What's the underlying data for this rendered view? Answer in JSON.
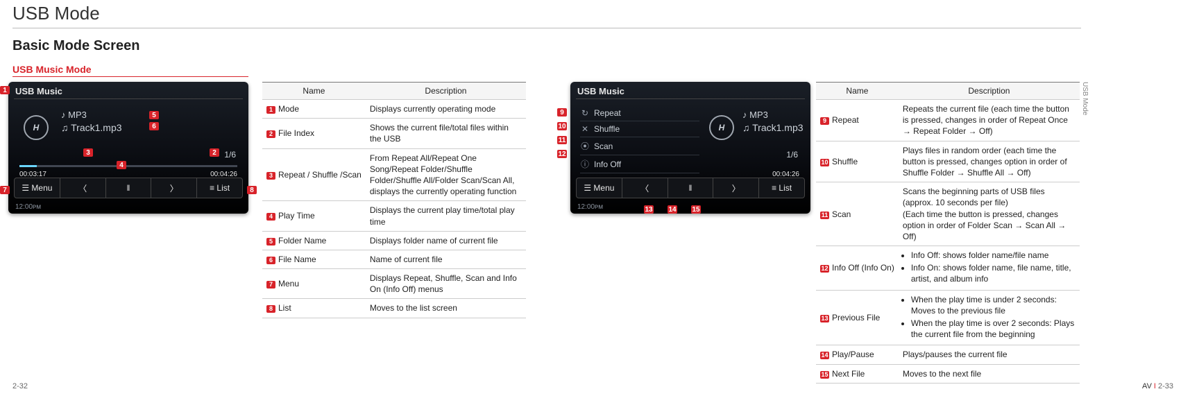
{
  "title": "USB Mode",
  "section": "Basic Mode Screen",
  "mode_label": "USB Music Mode",
  "side_label": "USB Mode",
  "footer": {
    "left": "2-32",
    "right_prefix": "AV",
    "right_num": "2-33"
  },
  "screen_a": {
    "header": "USB Music",
    "logo": "H",
    "mp3": "♪ MP3",
    "track": "♫ Track1.mp3",
    "index": "1/6",
    "time_l": "00:03:17",
    "time_r": "00:04:26",
    "btn_menu": "☰  Menu",
    "btn_prev": "〈",
    "btn_play": "‖",
    "btn_next": "〉",
    "btn_list": "≡  List",
    "clock": "12:00ᴘᴍ"
  },
  "screen_b": {
    "header": "USB Music",
    "logo": "H",
    "mp3": "♪ MP3",
    "track": "♫ Track1.mp3",
    "index": "1/6",
    "time_l": "",
    "time_r": "00:04:26",
    "m1_icon": "↻",
    "m1": "Repeat",
    "m2_icon": "✕",
    "m2": "Shuffle",
    "m3_icon": "⦿",
    "m3": "Scan",
    "m4_icon": "ⓘ",
    "m4": "Info Off",
    "btn_menu": "☰  Menu",
    "btn_prev": "〈",
    "btn_play": "‖",
    "btn_next": "〉",
    "btn_list": "≡  List",
    "clock": "12:00ᴘᴍ"
  },
  "callouts_a": {
    "n1": "1",
    "n2": "2",
    "n3": "3",
    "n4": "4",
    "n5": "5",
    "n6": "6",
    "n7": "7",
    "n8": "8"
  },
  "callouts_b": {
    "n9": "9",
    "n10": "10",
    "n11": "11",
    "n12": "12",
    "n13": "13",
    "n14": "14",
    "n15": "15"
  },
  "table1": {
    "h_name": "Name",
    "h_desc": "Description",
    "rows": [
      {
        "num": "1",
        "name": "Mode",
        "desc": "Displays currently operating mode"
      },
      {
        "num": "2",
        "name": "File Index",
        "desc": "Shows the current file/total files within the USB"
      },
      {
        "num": "3",
        "name": "Repeat / Shuffle /Scan",
        "desc": "From Repeat All/Repeat One Song/Repeat Folder/Shuffle Folder/Shuffle All/Folder Scan/Scan All, displays the  currently operating function"
      },
      {
        "num": "4",
        "name": "Play Time",
        "desc": "Displays the current play time/total play time"
      },
      {
        "num": "5",
        "name": "Folder Name",
        "desc": "Displays folder name of current file"
      },
      {
        "num": "6",
        "name": "File Name",
        "desc": "Name of current file"
      },
      {
        "num": "7",
        "name": "Menu",
        "desc": "Displays Repeat, Shuffle, Scan and Info On (Info Off) menus"
      },
      {
        "num": "8",
        "name": "List",
        "desc": "Moves to the list screen"
      }
    ]
  },
  "table2": {
    "h_name": "Name",
    "h_desc": "Description",
    "rows": [
      {
        "num": "9",
        "name": "Repeat",
        "desc": "Repeats the current file (each time the button is pressed, changes in order of Repeat Once → Repeat Folder → Off)"
      },
      {
        "num": "10",
        "name": "Shuffle",
        "desc": "Plays files in random order (each time the button is pressed, changes option in order of Shuffle Folder → Shuffle All → Off)"
      },
      {
        "num": "11",
        "name": "Scan",
        "desc": "Scans the beginning parts of USB files (approx. 10 seconds per file)\n(Each time the button is pressed, changes option in order of Folder Scan → Scan All → Off)"
      },
      {
        "num": "12",
        "name": "Info Off (Info On)",
        "desc_list": [
          "Info Off: shows folder name/file name",
          "Info On: shows folder name, file name, title, artist, and album info"
        ]
      },
      {
        "num": "13",
        "name": "Previous File",
        "desc_list": [
          "When the play time is under 2 seconds: Moves to the previous file",
          "When the play time is over 2 seconds: Plays the current file from the beginning"
        ]
      },
      {
        "num": "14",
        "name": "Play/Pause",
        "desc": "Plays/pauses the current file"
      },
      {
        "num": "15",
        "name": "Next File",
        "desc": "Moves to the next file"
      }
    ]
  }
}
